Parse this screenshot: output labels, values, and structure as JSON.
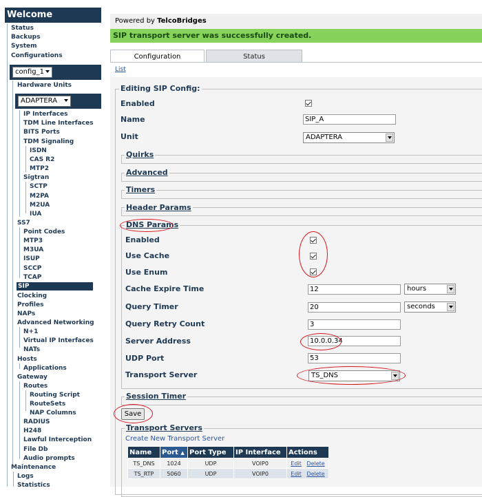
{
  "sidebar": {
    "title": "Welcome",
    "top_items": [
      "Status",
      "Backups",
      "System",
      "Configurations"
    ],
    "config_select": "config_1",
    "hardware_units": "Hardware Units",
    "unit_select": "ADAPTERA",
    "unit_items": [
      "IP Interfaces",
      "TDM Line Interfaces",
      "BITS Ports",
      "TDM Signaling"
    ],
    "tdm_sub": [
      "ISDN",
      "CAS R2",
      "MTP2"
    ],
    "sigtran": "Sigtran",
    "sigtran_sub": [
      "SCTP",
      "M2PA",
      "M2UA",
      "IUA"
    ],
    "ss7": "SS7",
    "ss7_sub": [
      "Point Codes",
      "MTP3",
      "M3UA",
      "ISUP",
      "SCCP",
      "TCAP"
    ],
    "sip": "SIP",
    "mid_items": [
      "Clocking",
      "Profiles",
      "NAPs",
      "Advanced Networking"
    ],
    "adv_sub": [
      "N+1",
      "Virtual IP Interfaces",
      "NATs"
    ],
    "hosts": "Hosts",
    "hosts_sub": [
      "Applications"
    ],
    "gateway": "Gateway",
    "gw_routes": "Routes",
    "routes_sub": [
      "Routing Script",
      "RouteSets",
      "NAP Columns"
    ],
    "gw_sub": [
      "RADIUS",
      "H248",
      "Lawful Interception",
      "File Db",
      "Audio prompts"
    ],
    "maintenance": "Maintenance",
    "maint_sub": [
      "Logs",
      "Statistics"
    ]
  },
  "header": {
    "powered_prefix": "Powered by ",
    "powered_brand": "TelcoBridges",
    "success_message": "SIP transport server was successfully created."
  },
  "tabs": [
    "Configuration",
    "Status"
  ],
  "list_link": "List",
  "form": {
    "legend": "Editing SIP Config:",
    "enabled_label": "Enabled",
    "name_label": "Name",
    "name_value": "SIP_A",
    "unit_label": "Unit",
    "unit_value": "ADAPTERA",
    "sections": [
      "Quirks",
      "Advanced",
      "Timers",
      "Header Params"
    ],
    "dns": {
      "legend": "DNS Params",
      "enabled": "Enabled",
      "use_cache": "Use Cache",
      "use_enum": "Use Enum",
      "cache_expire_label": "Cache Expire Time",
      "cache_expire_value": "12",
      "cache_expire_unit": "hours",
      "query_timer_label": "Query Timer",
      "query_timer_value": "20",
      "query_timer_unit": "seconds",
      "query_retry_label": "Query Retry Count",
      "query_retry_value": "3",
      "server_address_label": "Server Address",
      "server_address_value": "10.0.0.34",
      "udp_port_label": "UDP Port",
      "udp_port_value": "53",
      "transport_label": "Transport Server",
      "transport_value": "TS_DNS"
    },
    "session_timer": "Session Timer",
    "save": "Save"
  },
  "transport_servers": {
    "legend": "Transport Servers",
    "create_link": "Create New Transport Server",
    "columns": [
      "Name",
      "Port",
      "Port Type",
      "IP Interface",
      "Actions"
    ],
    "rows": [
      {
        "name": "TS_DNS",
        "port": "1024",
        "type": "UDP",
        "ip": "VOIP0",
        "edit": "Edit",
        "delete": "Delete"
      },
      {
        "name": "TS_RTP",
        "port": "5060",
        "type": "UDP",
        "ip": "VOIP0",
        "edit": "Edit",
        "delete": "Delete"
      }
    ]
  },
  "colors": {
    "nav_dark": "#1e3954",
    "success_green": "#86d35c",
    "annotation_red": "#d9141b"
  }
}
